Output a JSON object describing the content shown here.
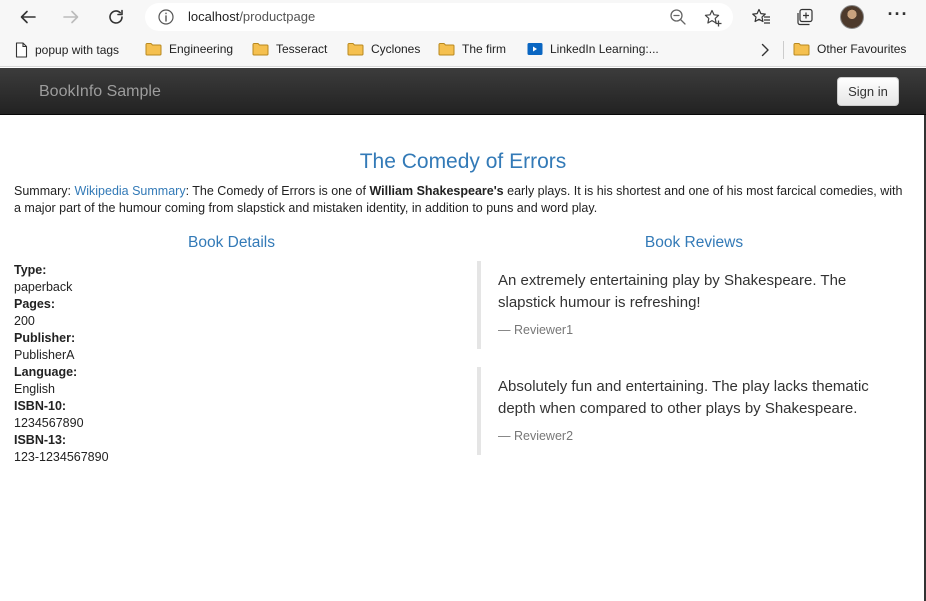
{
  "browser": {
    "url_host": "localhost",
    "url_path": "/productpage"
  },
  "bookmarks": [
    {
      "label": "popup with tags",
      "icon": "page-icon"
    },
    {
      "label": "Engineering",
      "icon": "folder-icon"
    },
    {
      "label": "Tesseract",
      "icon": "folder-icon"
    },
    {
      "label": "Cyclones",
      "icon": "folder-icon"
    },
    {
      "label": "The firm",
      "icon": "folder-icon"
    },
    {
      "label": "LinkedIn Learning:...",
      "icon": "linkedin-learning-icon"
    },
    {
      "label": "Other Favourites",
      "icon": "folder-icon"
    }
  ],
  "colors": {
    "link": "#337ab7",
    "navbar": "#222222",
    "folder": "#f5c04f"
  },
  "app": {
    "brand": "BookInfo Sample",
    "sign_in": "Sign in"
  },
  "book": {
    "title": "The Comedy of Errors",
    "summary_prefix": "Summary: ",
    "summary_link": "Wikipedia Summary",
    "summary_text_1": ": The Comedy of Errors is one of ",
    "summary_bold": "William Shakespeare's",
    "summary_text_2": " early plays. It is his shortest and one of his most farcical comedies, with a major part of the humour coming from slapstick and mistaken identity, in addition to puns and word play."
  },
  "details": {
    "heading": "Book Details",
    "fields": [
      {
        "label": "Type:",
        "value": "paperback"
      },
      {
        "label": "Pages:",
        "value": "200"
      },
      {
        "label": "Publisher:",
        "value": "PublisherA"
      },
      {
        "label": "Language:",
        "value": "English"
      },
      {
        "label": "ISBN-10:",
        "value": "1234567890"
      },
      {
        "label": "ISBN-13:",
        "value": "123-1234567890"
      }
    ]
  },
  "reviews": {
    "heading": "Book Reviews",
    "items": [
      {
        "text": "An extremely entertaining play by Shakespeare. The slapstick humour is refreshing!",
        "author": "— Reviewer1"
      },
      {
        "text": "Absolutely fun and entertaining. The play lacks thematic depth when compared to other plays by Shakespeare.",
        "author": "— Reviewer2"
      }
    ]
  }
}
